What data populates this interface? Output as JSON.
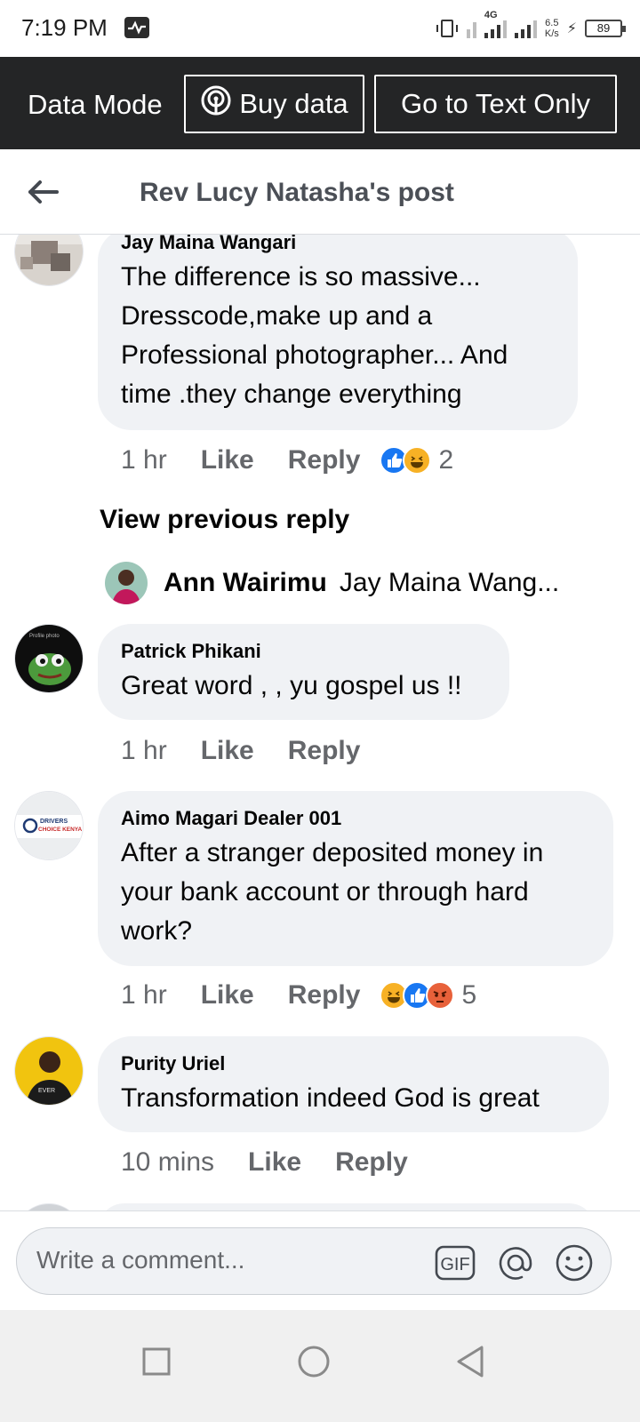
{
  "status_bar": {
    "time": "7:19 PM",
    "network": "4G",
    "speed_value": "6.5",
    "speed_unit": "K/s",
    "battery": "89"
  },
  "data_mode_bar": {
    "label": "Data Mode",
    "buy_data": "Buy data",
    "text_only": "Go to Text Only"
  },
  "header": {
    "title": "Rev Lucy Natasha's post"
  },
  "comments": [
    {
      "author": "Jay Maina Wangari",
      "lines": [
        "The difference is so massive...",
        "Dresscode,make up and a",
        "Professional photographer... And",
        "time .they change everything"
      ],
      "time": "1 hr",
      "like": "Like",
      "reply": "Reply",
      "reactions": [
        "like",
        "haha"
      ],
      "reaction_count": "2"
    },
    {
      "author": "Patrick Phikani",
      "lines": [
        "Great word , , yu gospel us !!"
      ],
      "time": "1 hr",
      "like": "Like",
      "reply": "Reply",
      "reactions": [],
      "reaction_count": ""
    },
    {
      "author": "Aimo Magari Dealer 001",
      "lines": [
        "After a stranger deposited money in",
        "your bank account or through hard",
        "work?"
      ],
      "time": "1 hr",
      "like": "Like",
      "reply": "Reply",
      "reactions": [
        "haha",
        "like",
        "angry"
      ],
      "reaction_count": "5"
    },
    {
      "author": "Purity Uriel",
      "lines": [
        "Transformation indeed God is great"
      ],
      "time": "10 mins",
      "like": "Like",
      "reply": "Reply",
      "reactions": [],
      "reaction_count": ""
    }
  ],
  "view_previous_reply": "View previous reply",
  "reply_preview": {
    "author": "Ann Wairimu",
    "snippet": "Jay Maina Wang..."
  },
  "avatar_text": {
    "patrick": "Profile photo",
    "aimo_line1": "DRIVERS",
    "aimo_line2": "CHOICE KENYA",
    "purity": "EVER"
  },
  "comment_bar": {
    "placeholder": "Write a comment...",
    "gif": "GIF"
  },
  "icons": [
    "back-arrow-icon",
    "hotspot-icon",
    "gif-icon",
    "mention-icon",
    "emoji-icon",
    "recents-icon",
    "home-icon",
    "back-icon"
  ],
  "colors": {
    "data_bar_bg": "#242526",
    "bubble_bg": "#f0f2f5",
    "secondary_text": "#65676b",
    "like_blue": "#1877f2",
    "haha_yellow": "#f7b125",
    "angry_orange": "#e8613a"
  }
}
